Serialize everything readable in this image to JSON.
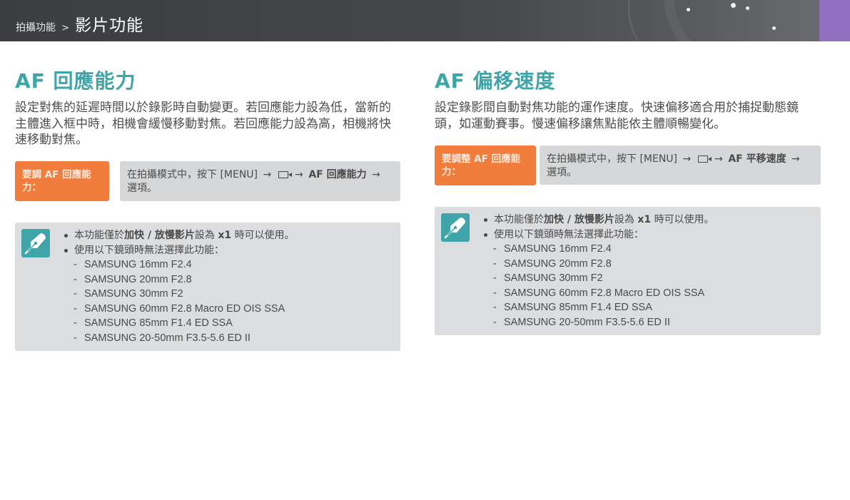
{
  "header": {
    "parent_label": "拍攝功能",
    "separator": ">",
    "current_label": "影片功能"
  },
  "left": {
    "title": "AF 回應能力",
    "description": "設定對焦的延遲時間以於錄影時自動變更。若回應能力設為低，當新的主體進入框中時，相機會緩慢移動對焦。若回應能力設為高，相機將快速移動對焦。",
    "howto_label": "要調 AF 回應能力：",
    "steps_prefix": "在拍攝模式中，按下 [MENU]",
    "arrow": "→",
    "steps_bold": "AF 回應能力",
    "steps_suffix": "選項。",
    "note": {
      "bullet1_pre": "本功能僅於",
      "bullet1_bold": "加快 / 放慢影片",
      "bullet1_mid": "設為",
      "bullet1_bold2": "x1",
      "bullet1_post": "時可以使用。",
      "bullet2": "使用以下鏡頭時無法選擇此功能：",
      "lenses": [
        "SAMSUNG 16mm F2.4",
        "SAMSUNG 20mm F2.8",
        "SAMSUNG 30mm F2",
        "SAMSUNG 60mm F2.8 Macro ED OIS SSA",
        "SAMSUNG 85mm F1.4 ED SSA",
        "SAMSUNG 20-50mm F3.5-5.6 ED II"
      ]
    }
  },
  "right": {
    "title": "AF 偏移速度",
    "description": "設定錄影間自動對焦功能的運作速度。快速偏移適合用於捕捉動態鏡頭，如運動賽事。慢速偏移讓焦點能依主體順暢變化。",
    "howto_label": "要調整 AF 回應能力：",
    "steps_prefix": "在拍攝模式中，按下 [MENU]",
    "arrow": "→",
    "steps_bold": "AF 平移速度",
    "steps_suffix": "選項。",
    "note": {
      "bullet1_pre": "本功能僅於",
      "bullet1_bold": "加快 / 放慢影片",
      "bullet1_mid": "設為",
      "bullet1_bold2": "x1",
      "bullet1_post": "時可以使用。",
      "bullet2": "使用以下鏡頭時無法選擇此功能：",
      "lenses": [
        "SAMSUNG 16mm F2.4",
        "SAMSUNG 20mm F2.8",
        "SAMSUNG 30mm F2",
        "SAMSUNG 60mm F2.8 Macro ED OIS SSA",
        "SAMSUNG 85mm F1.4 ED SSA",
        "SAMSUNG 20-50mm F3.5-5.6 ED II"
      ]
    }
  },
  "icons": {
    "movie": "movie-mode-icon",
    "note": "pen-nib-note-icon"
  },
  "colors": {
    "title": "#3fa5a8",
    "howto_label_bg": "#f07d3b",
    "steps_bg": "#d6d7d8",
    "note_bg": "#dcdddf",
    "header_accent": "#9171bf"
  }
}
